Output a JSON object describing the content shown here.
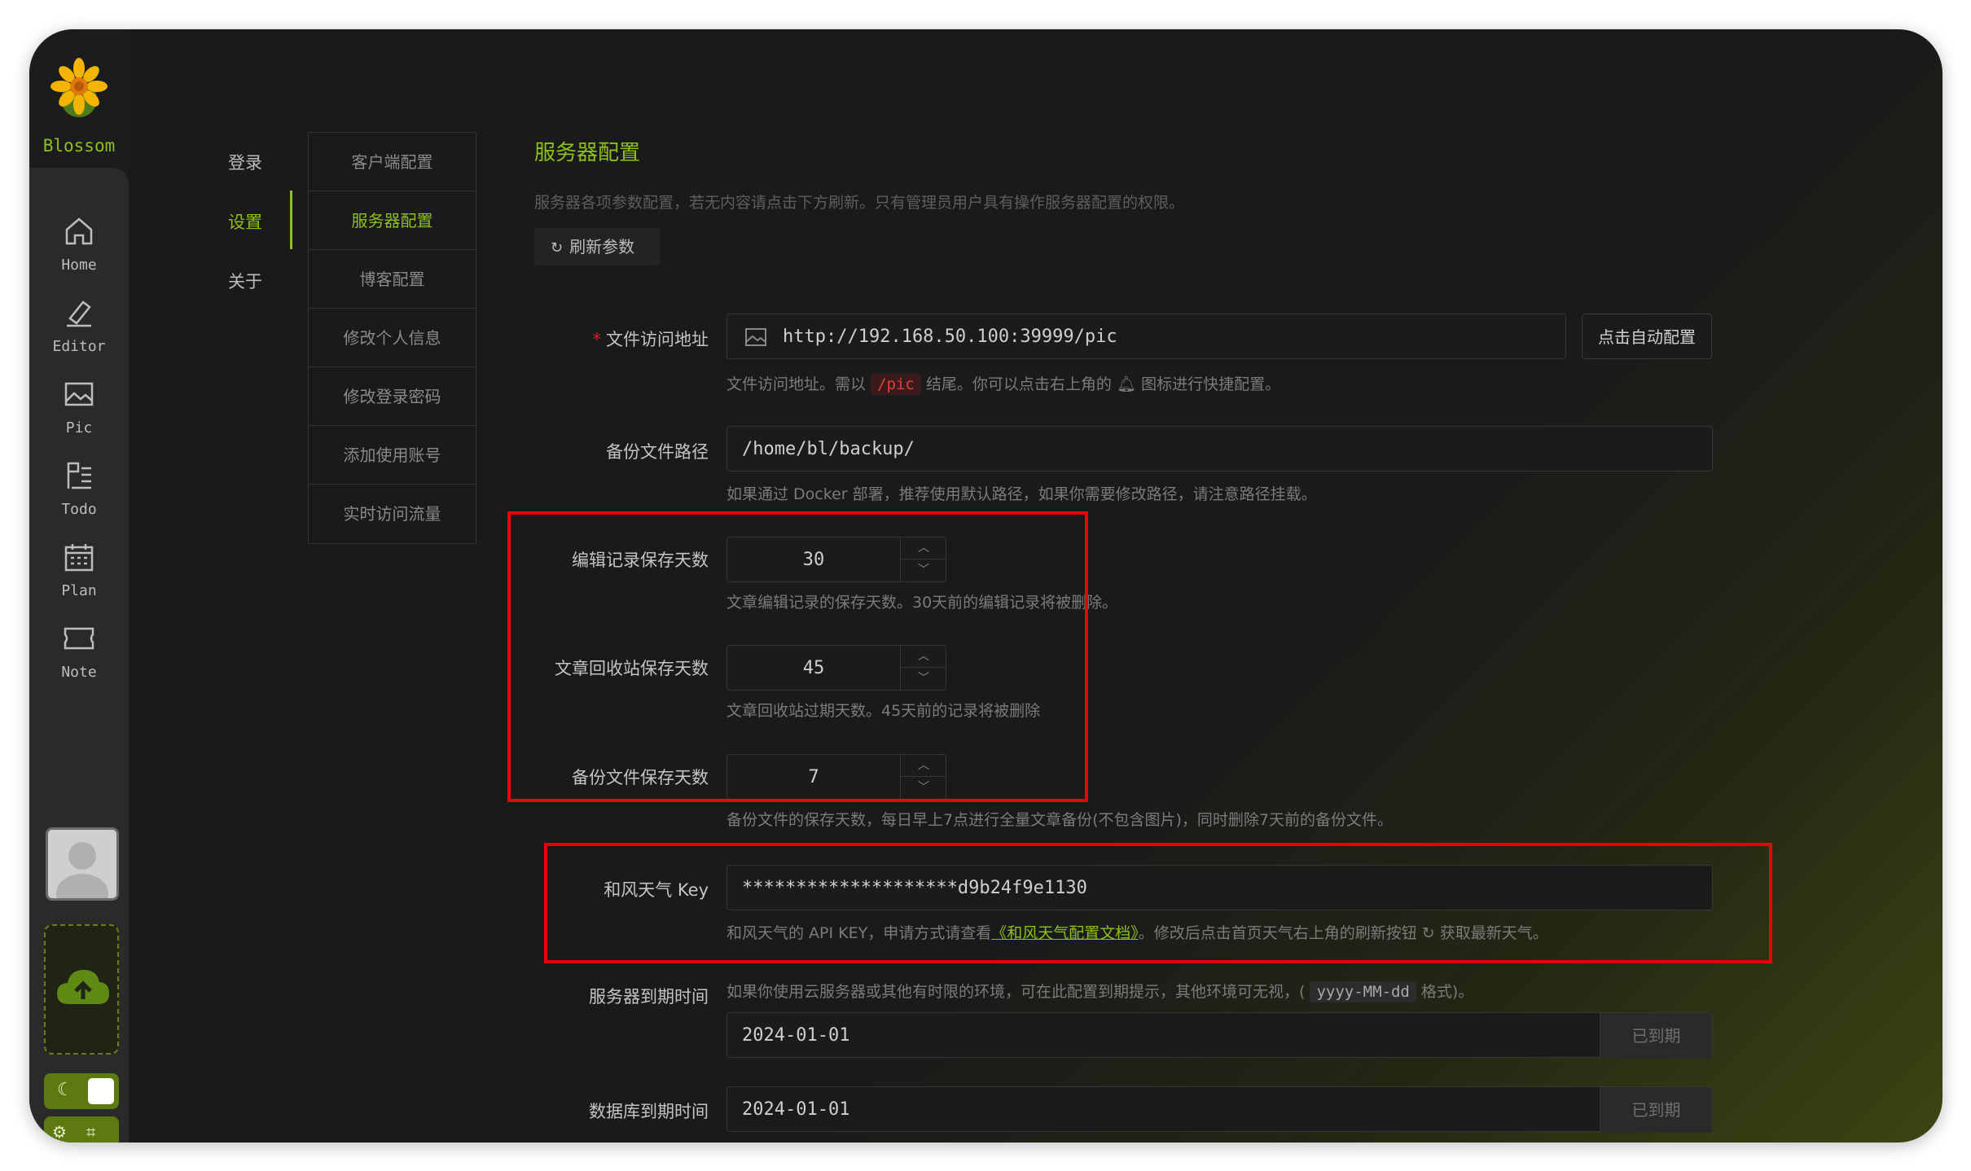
{
  "app": {
    "logo_text": "Blossom"
  },
  "rail": {
    "items": [
      {
        "label": "Home",
        "icon": "home-icon"
      },
      {
        "label": "Editor",
        "icon": "editor-icon"
      },
      {
        "label": "Pic",
        "icon": "image-icon"
      },
      {
        "label": "Todo",
        "icon": "todo-icon"
      },
      {
        "label": "Plan",
        "icon": "calendar-icon"
      },
      {
        "label": "Note",
        "icon": "ticket-icon"
      }
    ]
  },
  "top_nav": {
    "login": "登录",
    "settings": "设置",
    "about": "关于",
    "active": "设置"
  },
  "sub_nav": {
    "items": [
      "客户端配置",
      "服务器配置",
      "博客配置",
      "修改个人信息",
      "修改登录密码",
      "添加使用账号",
      "实时访问流量"
    ],
    "active": "服务器配置"
  },
  "page": {
    "title": "服务器配置",
    "description": "服务器各项参数配置，若无内容请点击下方刷新。只有管理员用户具有操作服务器配置的权限。",
    "refresh_label": "刷新参数"
  },
  "fields": {
    "file_url": {
      "label": "文件访问地址",
      "required_mark": "*",
      "value": "http://192.168.50.100:39999/pic",
      "button": "点击自动配置",
      "help_pre": "文件访问地址。需以",
      "help_code": "/pic",
      "help_mid": "结尾。你可以点击右上角的",
      "help_post": "图标进行快捷配置。"
    },
    "backup_path": {
      "label": "备份文件路径",
      "value": "/home/bl/backup/",
      "help": "如果通过 Docker 部署，推荐使用默认路径，如果你需要修改路径，请注意路径挂载。"
    },
    "edit_days": {
      "label": "编辑记录保存天数",
      "value": "30",
      "help": "文章编辑记录的保存天数。30天前的编辑记录将被删除。"
    },
    "recycle_days": {
      "label": "文章回收站保存天数",
      "value": "45",
      "help": "文章回收站过期天数。45天前的记录将被删除"
    },
    "backup_days": {
      "label": "备份文件保存天数",
      "value": "7",
      "help": "备份文件的保存天数，每日早上7点进行全量文章备份(不包含图片)，同时删除7天前的备份文件。"
    },
    "weather_key": {
      "label": "和风天气 Key",
      "value": "********************d9b24f9e1130",
      "help_pre": "和风天气的 API KEY，申请方式请查看",
      "help_link": "《和风天气配置文档》",
      "help_mid": "。修改后点击首页天气右上角的刷新按钮",
      "help_post": "获取最新天气。"
    },
    "server_expire": {
      "label": "服务器到期时间",
      "help_pre": "如果你使用云服务器或其他有时限的环境，可在此配置到期提示，其他环境可无视，(",
      "help_code": "yyyy-MM-dd",
      "help_post": "格式)。",
      "value": "2024-01-01",
      "status": "已到期"
    },
    "db_expire": {
      "label": "数据库到期时间",
      "value": "2024-01-01",
      "status": "已到期"
    }
  },
  "colors": {
    "accent": "#8ec01c",
    "highlight_box": "#e8000b",
    "required": "#e02020"
  }
}
